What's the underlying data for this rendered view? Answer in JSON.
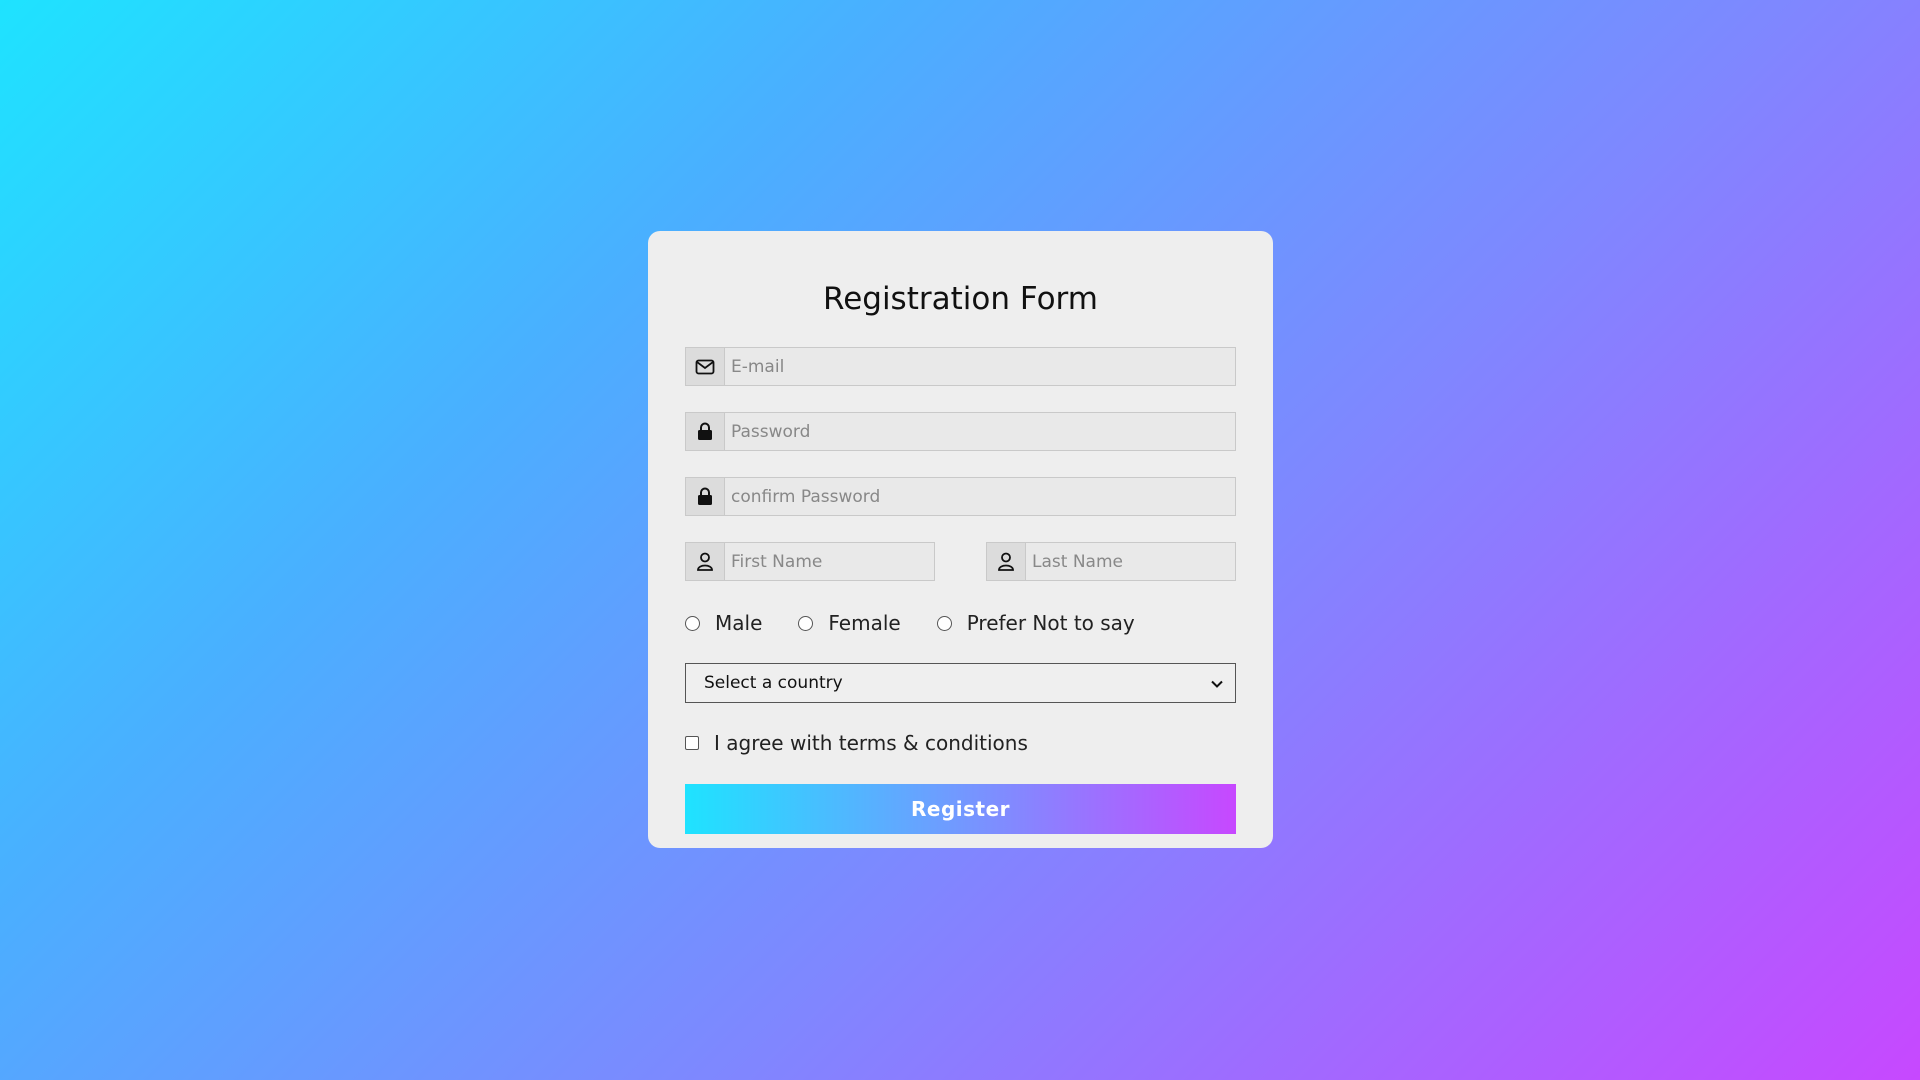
{
  "form": {
    "title": "Registration Form",
    "email_placeholder": "E-mail",
    "password_placeholder": "Password",
    "confirm_placeholder": "confirm Password",
    "first_name_placeholder": "First Name",
    "last_name_placeholder": "Last Name",
    "gender_options": [
      "Male",
      "Female",
      "Prefer Not to say"
    ],
    "country_select": "Select a country",
    "terms_label": "I agree with terms & conditions",
    "register_label": "Register"
  },
  "icons": {
    "email": "envelope-icon",
    "password": "lock-icon",
    "confirm": "lock-icon",
    "first_name": "user-icon",
    "last_name": "user-icon",
    "select": "chevron-down-icon"
  },
  "colors": {
    "gradient_start": "#1ee3ff",
    "gradient_end": "#c748ff",
    "card_bg": "#eeeeee"
  }
}
